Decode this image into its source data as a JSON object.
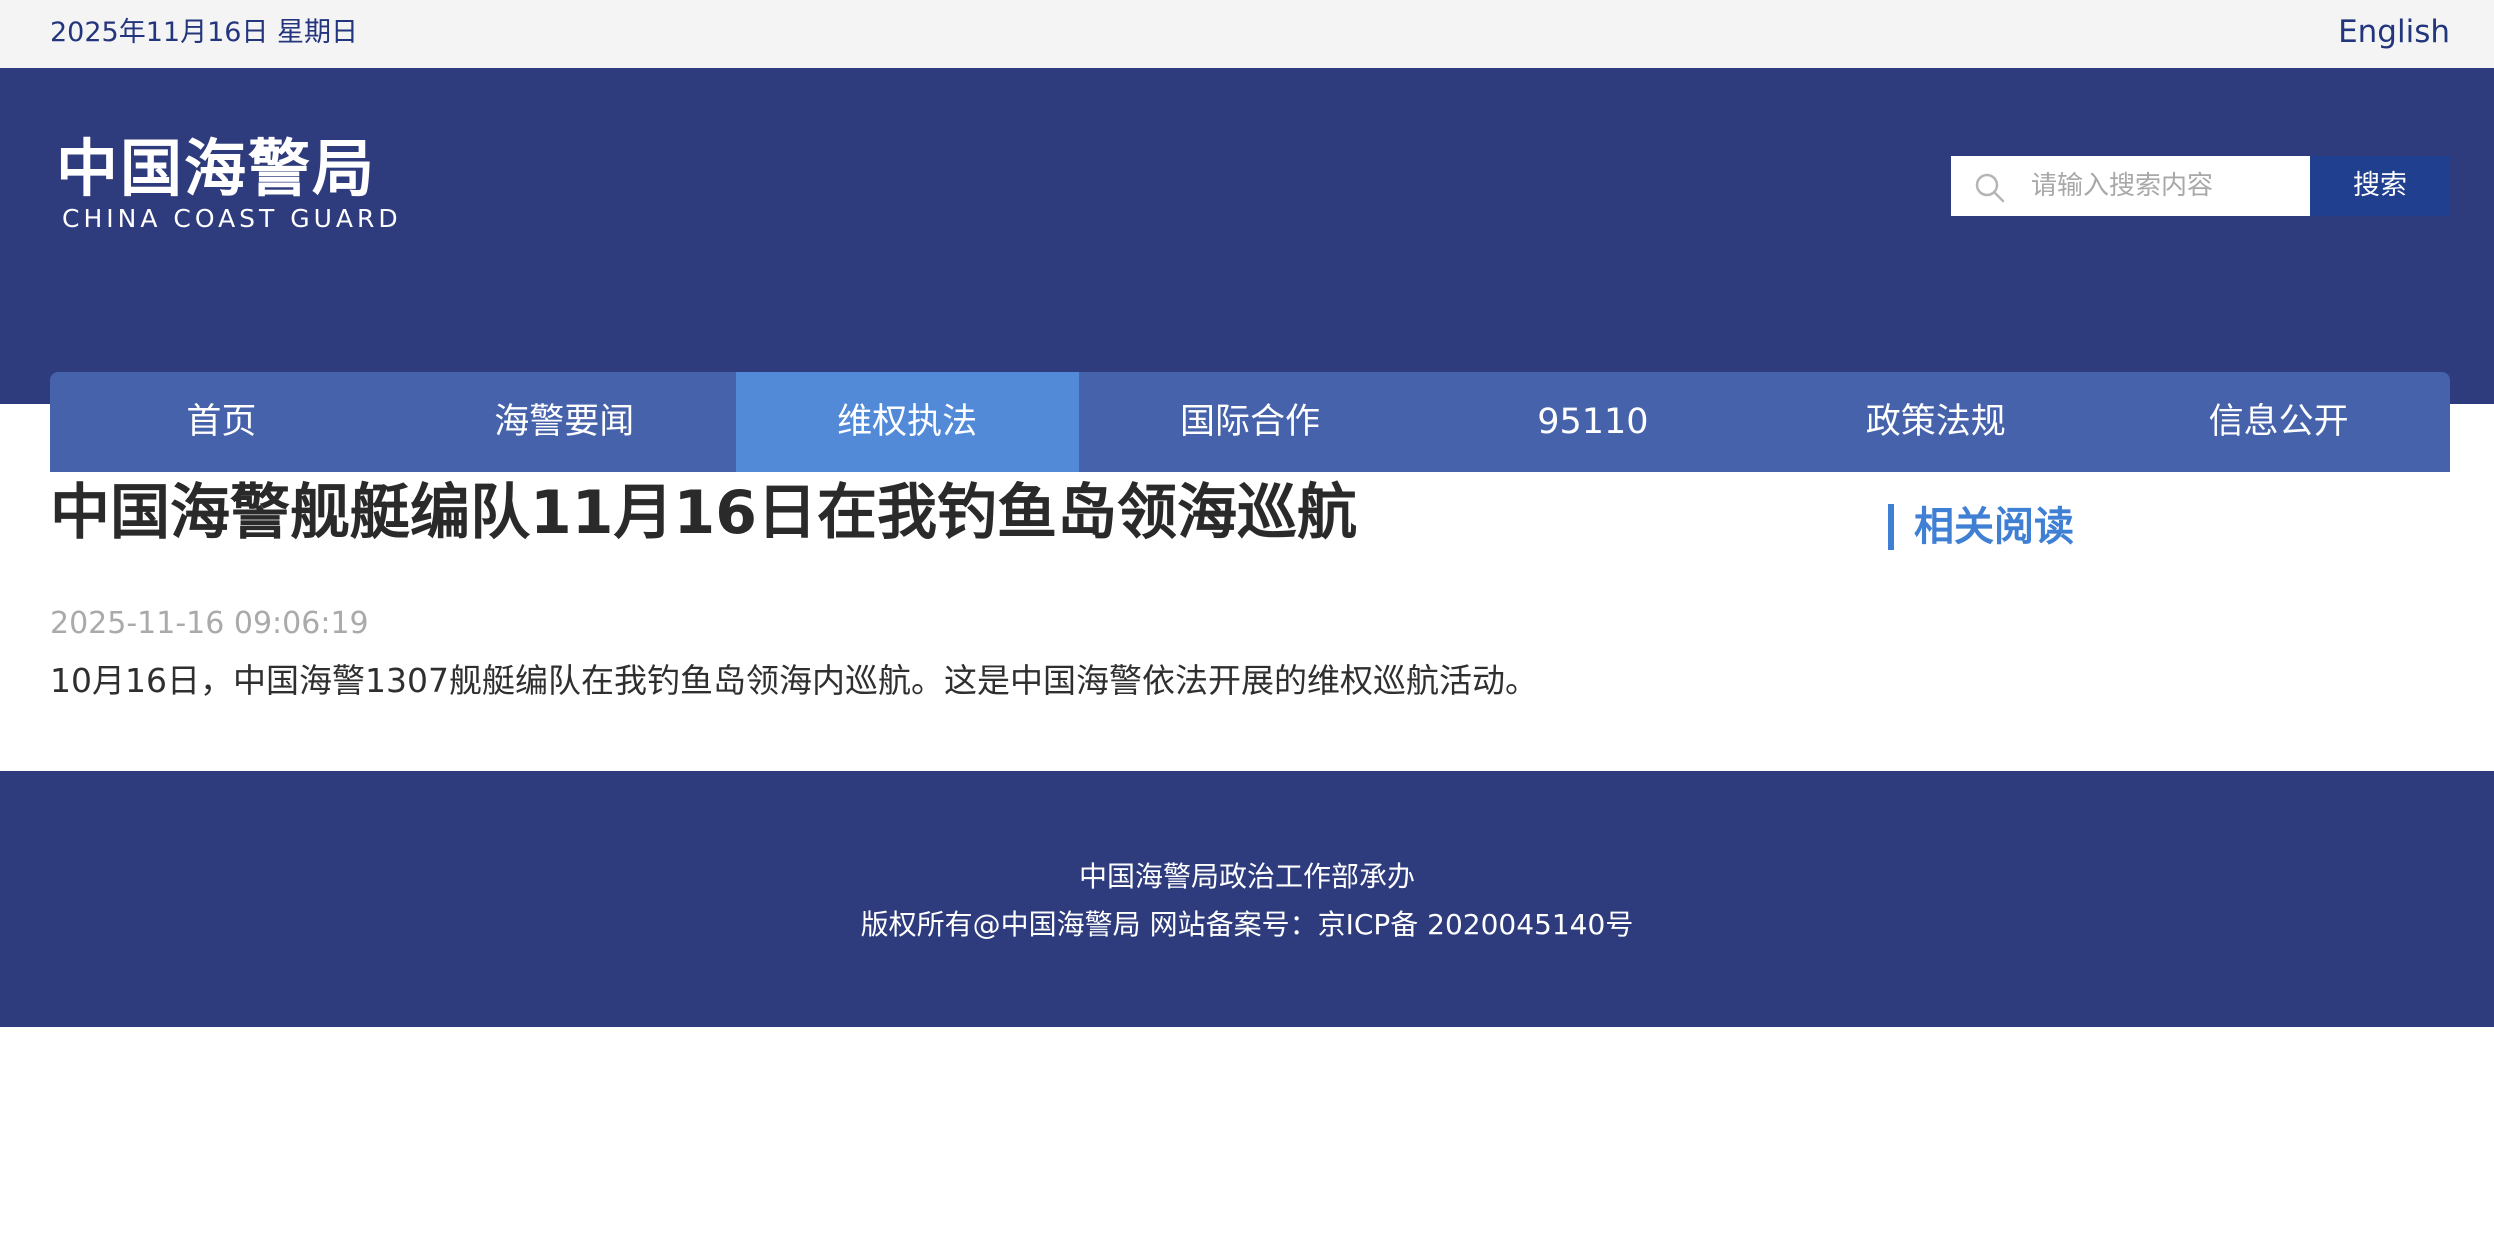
{
  "topbar": {
    "date": "2025年11月16日 星期日",
    "language_link": "English"
  },
  "logo": {
    "name_cn": "中国海警局",
    "name_en": "CHINA COAST GUARD"
  },
  "search": {
    "placeholder": "请输入搜索内容",
    "value": "",
    "button_label": "搜索",
    "icon": "search-icon"
  },
  "nav": {
    "items": [
      {
        "label": "首页",
        "active": false
      },
      {
        "label": "海警要闻",
        "active": false
      },
      {
        "label": "维权执法",
        "active": true
      },
      {
        "label": "国际合作",
        "active": false
      },
      {
        "label": "95110",
        "active": false
      },
      {
        "label": "政策法规",
        "active": false
      },
      {
        "label": "信息公开",
        "active": false
      }
    ]
  },
  "article": {
    "title": "中国海警舰艇编队11月16日在我钓鱼岛领海巡航",
    "published": "2025-11-16 09:06:19",
    "body": "10月16日，中国海警1307舰艇编队在我钓鱼岛领海内巡航。这是中国海警依法开展的维权巡航活动。"
  },
  "sidebar": {
    "related_heading": "相关阅读"
  },
  "footer": {
    "organizer": "中国海警局政治工作部承办",
    "copyright": "版权所有@中国海警局 网站备案号：京ICP备 2020045140号"
  },
  "colors": {
    "header_bg": "#2e3b7c",
    "nav_bg": "#4662ab",
    "nav_active": "#528ad8",
    "accent": "#3f7fd4",
    "search_button": "#213f8f"
  }
}
